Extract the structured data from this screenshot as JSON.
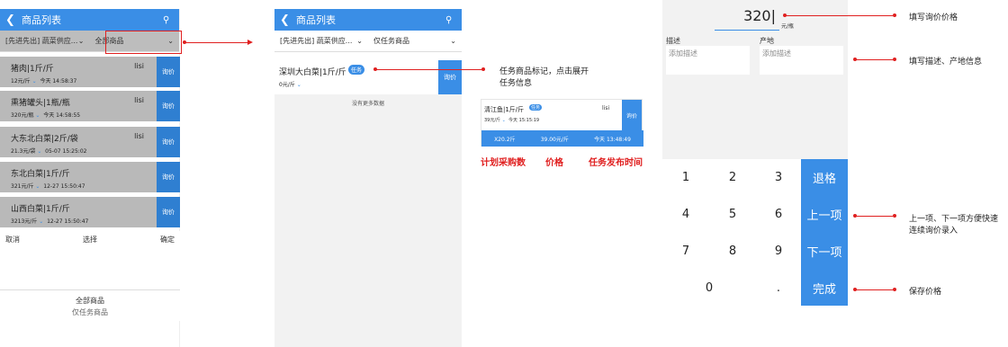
{
  "colors": {
    "primary": "#3a8ee6",
    "annotation": "#e02020",
    "overlay": "#b9b9b9"
  },
  "screen1": {
    "title": "商品列表",
    "filter_supplier": "[先进先出] 蔬菜供应...",
    "filter_scope": "全部商品",
    "items": [
      {
        "name": "猪肉|1斤/斤",
        "user": "lisi",
        "price": "12元/斤",
        "time": "今天 14:58:37",
        "ask": "询价"
      },
      {
        "name": "熏猪罐头|1瓶/瓶",
        "user": "lisi",
        "price": "320元/瓶",
        "time": "今天 14:58:55",
        "ask": "询价"
      },
      {
        "name": "大东北白菜|2斤/袋",
        "user": "lisi",
        "price": "21.3元/袋",
        "time": "05-07 15:25:02",
        "ask": "询价"
      },
      {
        "name": "东北白菜|1斤/斤",
        "user": "",
        "price": "321元/斤",
        "time": "12-27 15:50:47",
        "ask": "询价"
      },
      {
        "name": "山西白菜|1斤/斤",
        "user": "",
        "price": "3213元/斤",
        "time": "12-27 15:50:47",
        "ask": "询价"
      }
    ],
    "picker": {
      "cancel": "取消",
      "title": "选择",
      "confirm": "确定",
      "opt_all": "全部商品",
      "opt_task": "仅任务商品"
    }
  },
  "screen2": {
    "title": "商品列表",
    "filter_supplier": "[先进先出] 蔬菜供应...",
    "filter_scope": "仅任务商品",
    "item_name": "深圳大白菜|1斤/斤",
    "task_badge": "任务",
    "item_price": "0元/斤",
    "ask": "询价",
    "no_more": "没有更多数据",
    "detail": {
      "name": "清江鱼|1斤/斤",
      "badge": "任务",
      "user": "lisi",
      "price": "39元/斤",
      "time": "今天 15:15:19",
      "ask": "询价",
      "qty": "X20.2斤",
      "task_price": "39.00元/斤",
      "task_time": "今天 13:48:49"
    }
  },
  "screen3": {
    "price_value": "320",
    "price_unit": "元/瓶",
    "desc_label": "描述",
    "desc_placeholder": "添加描述",
    "origin_label": "产地",
    "origin_placeholder": "添加描述",
    "keys": {
      "k1": "1",
      "k2": "2",
      "k3": "3",
      "k4": "4",
      "k5": "5",
      "k6": "6",
      "k7": "7",
      "k8": "8",
      "k9": "9",
      "k0": ".",
      "kzero": "0",
      "backspace": "退格",
      "prev": "上一项",
      "next": "下一项",
      "done": "完成"
    }
  },
  "annotations": {
    "task_mark": "任务商品标记，点击展开",
    "task_mark2": "任务信息",
    "qty": "计划采购数",
    "price": "价格",
    "time": "任务发布时间",
    "fill_price": "填写询价价格",
    "fill_desc": "填写描述、产地信息",
    "prev_next": "上一项、下一项方便快速",
    "prev_next2": "连续询价录入",
    "save": "保存价格"
  }
}
